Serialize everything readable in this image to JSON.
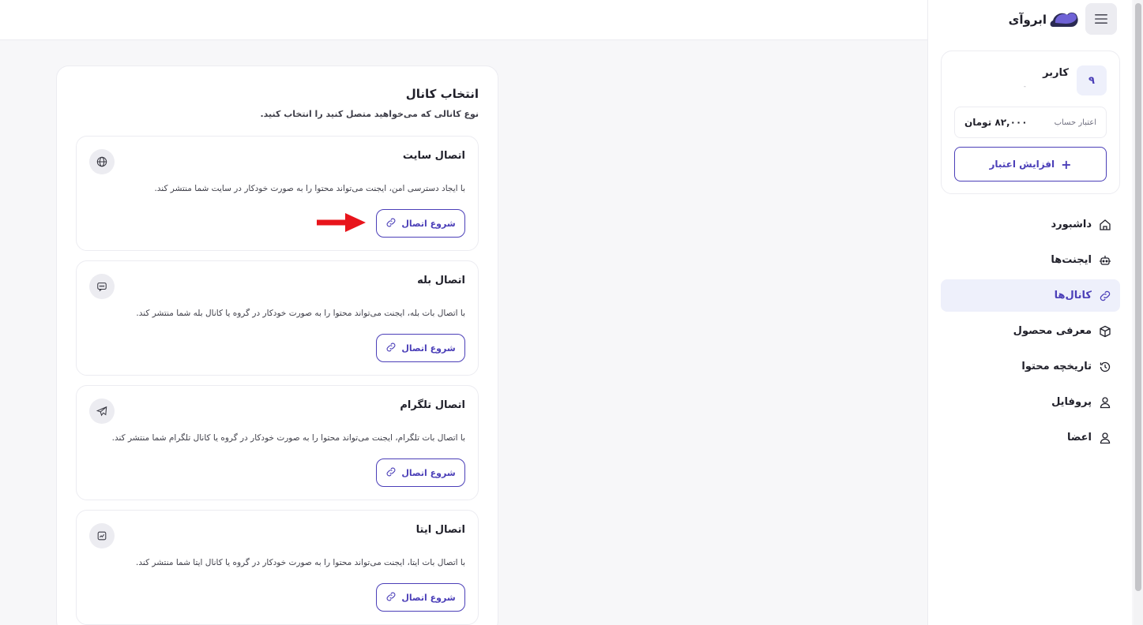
{
  "brand": {
    "name": "ابروآی"
  },
  "user": {
    "avatar_initial": "۹",
    "name": "کاربر",
    "subtitle": "-",
    "credit_label": "اعتبار حساب",
    "credit_value": "۸۲,۰۰۰ تومان",
    "add_credit_label": "افزایش اعتبار"
  },
  "nav": [
    {
      "label": "داشبورد",
      "icon": "home-icon"
    },
    {
      "label": "ایجنت‌ها",
      "icon": "robot-icon"
    },
    {
      "label": "کانال‌ها",
      "icon": "link-icon",
      "active": true
    },
    {
      "label": "معرفی محصول",
      "icon": "box-icon"
    },
    {
      "label": "تاریخچه محتوا",
      "icon": "history-icon"
    },
    {
      "label": "پروفایل",
      "icon": "user-icon"
    },
    {
      "label": "اعضا",
      "icon": "user-icon"
    }
  ],
  "main": {
    "title": "انتخاب کانال",
    "subtitle": "نوع کانالی که می‌خواهید متصل کنید را انتخاب کنید.",
    "channels": [
      {
        "title": "اتصال سایت",
        "desc": "با ایجاد دسترسی امن، ایجنت می‌تواند محتوا را به صورت خودکار در سایت شما منتشر کند.",
        "button": "شروع اتصال",
        "icon": "globe-icon"
      },
      {
        "title": "اتصال بله",
        "desc": "با اتصال بات بله، ایجنت می‌تواند محتوا را به صورت خودکار در گروه یا کانال بله شما منتشر کند.",
        "button": "شروع اتصال",
        "icon": "chat-icon"
      },
      {
        "title": "اتصال تلگرام",
        "desc": "با اتصال بات تلگرام، ایجنت می‌تواند محتوا را به صورت خودکار در گروه یا کانال تلگرام شما منتشر کند.",
        "button": "شروع اتصال",
        "icon": "telegram-icon"
      },
      {
        "title": "اتصال ایتا",
        "desc": "با اتصال بات ایتا، ایجنت می‌تواند محتوا را به صورت خودکار در گروه یا کانال ایتا شما منتشر کند.",
        "button": "شروع اتصال",
        "icon": "eitaa-icon"
      }
    ]
  },
  "colors": {
    "accent": "#4b3fb8",
    "annotation_arrow": "#e8141b"
  }
}
